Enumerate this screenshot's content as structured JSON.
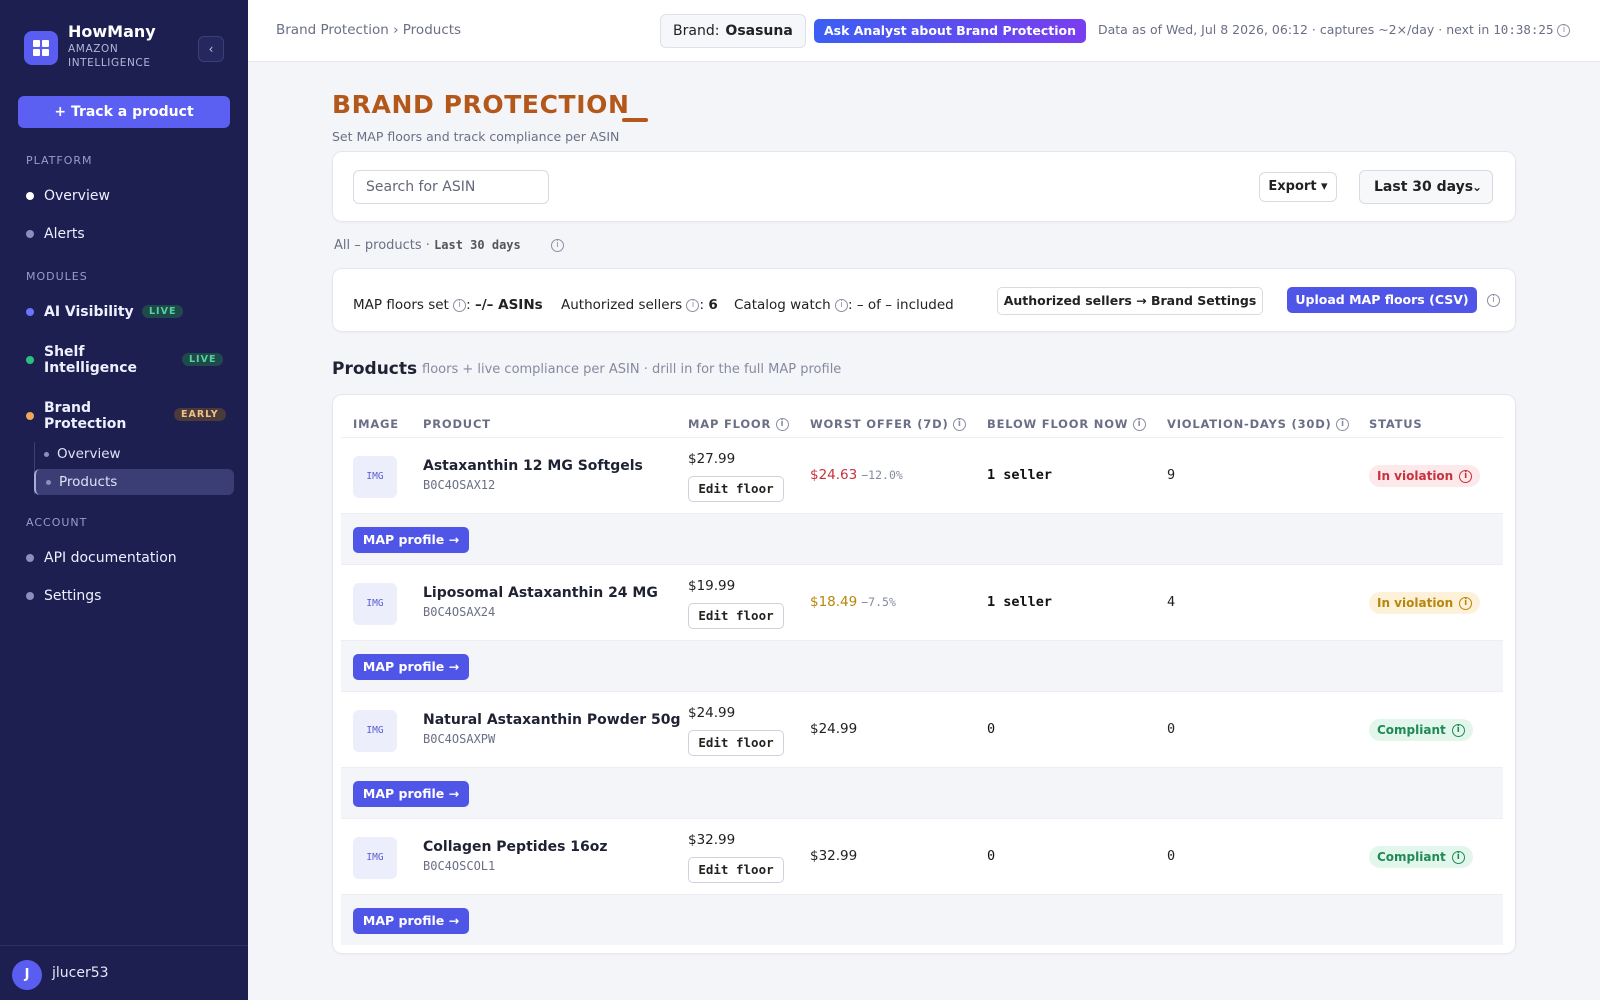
{
  "sidebar": {
    "brand_name": "HowMany",
    "brand_sub": "AMAZON INTELLIGENCE",
    "collapse_icon": "‹",
    "track_button": "+ Track a product",
    "sections": {
      "platform": "PLATFORM",
      "modules": "MODULES",
      "account": "ACCOUNT"
    },
    "platform_items": [
      "Overview",
      "Alerts"
    ],
    "modules": [
      {
        "label": "AI Visibility",
        "badge": "LIVE",
        "color": "#6b73ff"
      },
      {
        "label": "Shelf Intelligence",
        "badge": "LIVE",
        "color": "#2bbf82"
      },
      {
        "label": "Brand Protection",
        "badge": "EARLY",
        "color": "#f0a65a"
      }
    ],
    "brand_sub_items": [
      "Overview",
      "Products"
    ],
    "account_items": [
      "API documentation",
      "Settings"
    ],
    "user": {
      "initial": "J",
      "name": "jlucer53"
    }
  },
  "topbar": {
    "breadcrumb": "Brand Protection › Products",
    "brand_label": "Brand:",
    "brand_value": "Osasuna",
    "ask_button": "Ask Analyst about Brand Protection",
    "data_as_of": "Data as of Wed, Jul 8 2026, 06:12 · captures ~2×/day · next in",
    "countdown": "10:38:25"
  },
  "page": {
    "title": "BRAND PROTECTION",
    "subtitle": "Set MAP floors and track compliance per ASIN"
  },
  "toolbar": {
    "search_placeholder": "Search for ASIN",
    "export_label": "Export ▾",
    "range_label": "Last 30 days",
    "range_caret": "⌄"
  },
  "filter": {
    "prefix": "All – products ·",
    "range": "Last 30 days"
  },
  "stats": {
    "map_label": "MAP floors set",
    "map_value": "–/– ASINs",
    "auth_label": "Authorized sellers",
    "auth_value": "6",
    "catalog_label": "Catalog watch",
    "catalog_value": "– of – included",
    "auth_button": "Authorized sellers → Brand Settings",
    "upload_button": "Upload MAP floors (CSV)"
  },
  "products": {
    "heading": "Products",
    "subheading": "floors + live compliance per ASIN · drill in for the full MAP profile",
    "columns": [
      "IMAGE",
      "PRODUCT",
      "MAP FLOOR",
      "WORST OFFER (7D)",
      "BELOW FLOOR NOW",
      "VIOLATION-DAYS (30D)",
      "STATUS"
    ],
    "img_placeholder": "IMG",
    "edit_label": "Edit floor",
    "profile_label": "MAP profile →",
    "rows": [
      {
        "name": "Astaxanthin 12 MG Softgels",
        "asin": "B0C4OSAX12",
        "floor": "$27.99",
        "worst": "$24.63",
        "worst_pct": "−12.0%",
        "worst_color": "#c8323c",
        "below": "1 seller",
        "below_bold": true,
        "viol_days": "9",
        "status": "In violation",
        "status_fg": "#c8323c",
        "status_bg": "#fde8ea"
      },
      {
        "name": "Liposomal Astaxanthin 24 MG",
        "asin": "B0C4OSAX24",
        "floor": "$19.99",
        "worst": "$18.49",
        "worst_pct": "−7.5%",
        "worst_color": "#b8860b",
        "below": "1 seller",
        "below_bold": true,
        "viol_days": "4",
        "status": "In violation",
        "status_fg": "#b8860b",
        "status_bg": "#fdf1da"
      },
      {
        "name": "Natural Astaxanthin Powder 50g",
        "asin": "B0C4OSAXPW",
        "floor": "$24.99",
        "worst": "$24.99",
        "worst_pct": "",
        "worst_color": "#222222",
        "below": "0",
        "below_bold": false,
        "viol_days": "0",
        "status": "Compliant",
        "status_fg": "#1f8a55",
        "status_bg": "#e2f6ec"
      },
      {
        "name": "Collagen Peptides 16oz",
        "asin": "B0C4OSCOL1",
        "floor": "$32.99",
        "worst": "$32.99",
        "worst_pct": "",
        "worst_color": "#222222",
        "below": "0",
        "below_bold": false,
        "viol_days": "0",
        "status": "Compliant",
        "status_fg": "#1f8a55",
        "status_bg": "#e2f6ec"
      }
    ]
  }
}
